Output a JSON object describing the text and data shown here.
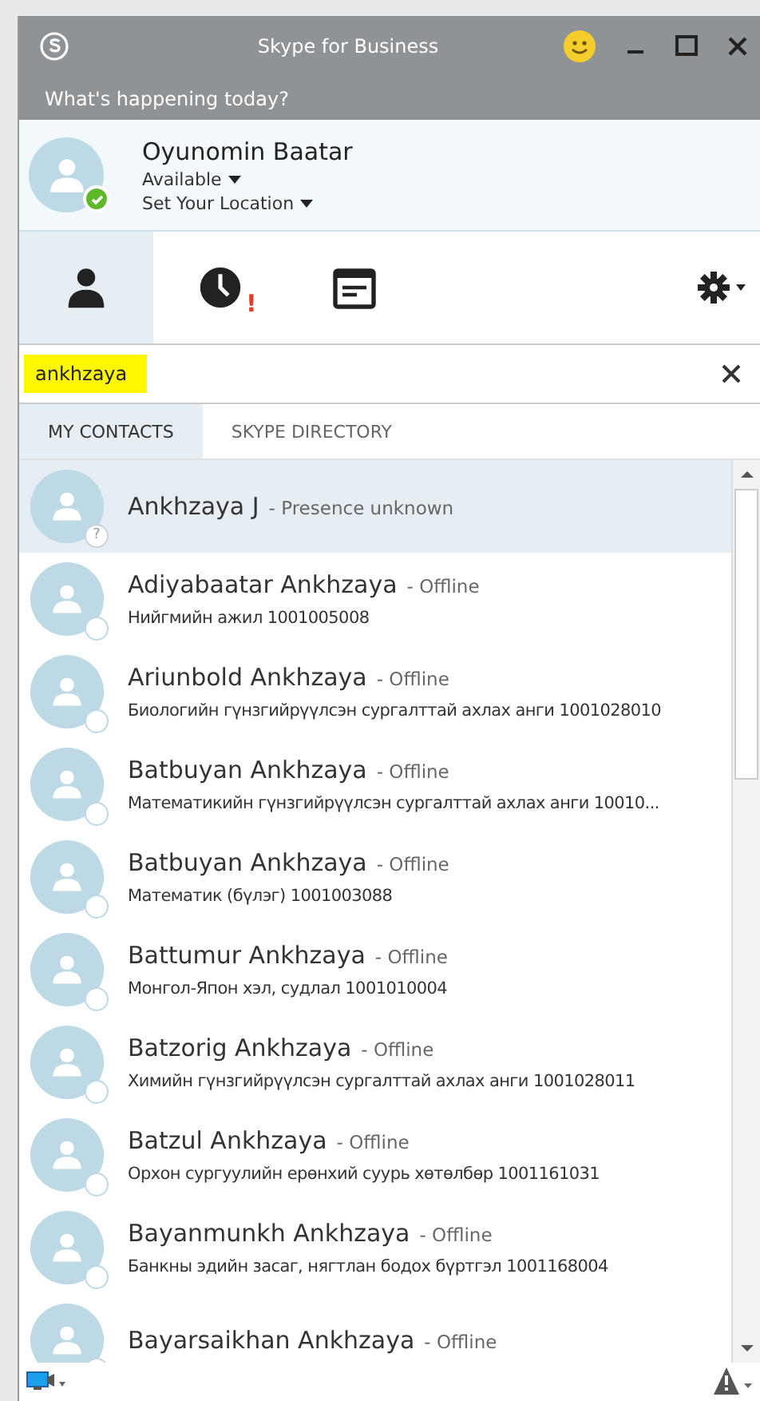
{
  "window": {
    "title": "Skype for Business"
  },
  "status_message": {
    "placeholder": "What's happening today?"
  },
  "profile": {
    "name": "Oyunomin Baatar",
    "availability": "Available",
    "location": "Set Your Location",
    "kind": "available"
  },
  "nav_tabs": [
    {
      "kind": "contacts",
      "selected": true
    },
    {
      "kind": "history",
      "selected": false,
      "alert": "!"
    },
    {
      "kind": "meetings",
      "selected": false
    }
  ],
  "search": {
    "value": "ankhzaya"
  },
  "list_tabs": [
    {
      "label": "MY CONTACTS",
      "selected": true
    },
    {
      "label": "SKYPE DIRECTORY",
      "selected": false
    }
  ],
  "contacts": [
    {
      "name": "Ankhzaya J",
      "status": "- Presence unknown",
      "kind": "unknown",
      "badge": "?",
      "selected": true
    },
    {
      "name": "Adiyabaatar Ankhzaya",
      "status": "- Offline",
      "subtitle": "Нийгмийн ажил 1001005008",
      "kind": "offline",
      "selected": false
    },
    {
      "name": "Ariunbold Ankhzaya",
      "status": "- Offline",
      "subtitle": "Биологийн гүнзгийрүүлсэн сургалттай ахлах анги 1001028010",
      "kind": "offline",
      "selected": false
    },
    {
      "name": "Batbuyan Ankhzaya",
      "status": "- Offline",
      "subtitle": "Математикийн гүнзгийрүүлсэн сургалттай ахлах анги 10010...",
      "kind": "offline",
      "selected": false
    },
    {
      "name": "Batbuyan Ankhzaya",
      "status": "- Offline",
      "subtitle": "Математик (бүлэг) 1001003088",
      "kind": "offline",
      "selected": false
    },
    {
      "name": "Battumur Ankhzaya",
      "status": "- Offline",
      "subtitle": "Монгол-Япон хэл, судлал 1001010004",
      "kind": "offline",
      "selected": false
    },
    {
      "name": "Batzorig Ankhzaya",
      "status": "- Offline",
      "subtitle": "Химийн гүнзгийрүүлсэн сургалттай ахлах анги 1001028011",
      "kind": "offline",
      "selected": false
    },
    {
      "name": "Batzul Ankhzaya",
      "status": "- Offline",
      "subtitle": "Орхон сургуулийн ерөнхий суурь хөтөлбөр 1001161031",
      "kind": "offline",
      "selected": false
    },
    {
      "name": "Bayanmunkh Ankhzaya",
      "status": "- Offline",
      "subtitle": "Банкны эдийн засаг, нягтлан бодох бүртгэл 1001168004",
      "kind": "offline",
      "selected": false
    },
    {
      "name": "Bayarsaikhan Ankhzaya",
      "status": "- Offline",
      "kind": "offline",
      "selected": false
    }
  ]
}
